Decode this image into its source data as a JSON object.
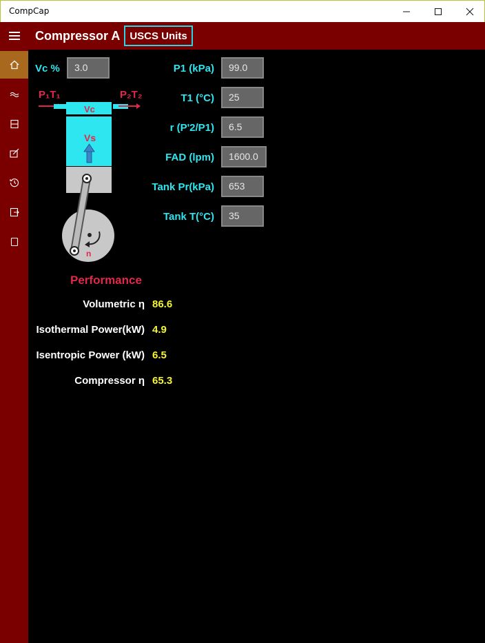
{
  "window": {
    "title": "CompCap"
  },
  "header": {
    "title": "Compressor A",
    "units_button": "USCS Units"
  },
  "sidebar": {
    "items": [
      {
        "icon": "home-icon",
        "active": true
      },
      {
        "icon": "flow-icon",
        "active": false
      },
      {
        "icon": "panel-icon",
        "active": false
      },
      {
        "icon": "edit-icon",
        "active": false
      },
      {
        "icon": "history-icon",
        "active": false
      },
      {
        "icon": "export-icon",
        "active": false
      },
      {
        "icon": "page-icon",
        "active": false
      }
    ]
  },
  "inputs": {
    "vc": {
      "label": "Vc %",
      "value": "3.0"
    },
    "p1": {
      "label": "P1 (kPa)",
      "value": "99.0"
    },
    "t1": {
      "label": "T1 (°C)",
      "value": "25"
    },
    "r": {
      "label": "r (P'2/P1)",
      "value": "6.5"
    },
    "fad": {
      "label": "FAD (lpm)",
      "value": "1600.0"
    },
    "tank_pr": {
      "label": "Tank Pr(kPa)",
      "value": "653"
    },
    "tank_t": {
      "label": "Tank T(°C)",
      "value": "35"
    }
  },
  "diagram": {
    "p1t1": "P₁T₁",
    "p2t2": "P₂T₂",
    "vc": "Vc",
    "vs": "Vs",
    "n": "n"
  },
  "performance": {
    "title": "Performance",
    "rows": [
      {
        "label": "Volumetric η",
        "value": "86.6"
      },
      {
        "label": "Isothermal Power(kW)",
        "value": "4.9"
      },
      {
        "label": "Isentropic Power (kW)",
        "value": "6.5"
      },
      {
        "label": "Compressor η",
        "value": "65.3"
      }
    ]
  },
  "colors": {
    "accent": "#7a0000",
    "cyan": "#2ee6f0",
    "yellow": "#f5f532",
    "perf_title": "#e0284b"
  }
}
